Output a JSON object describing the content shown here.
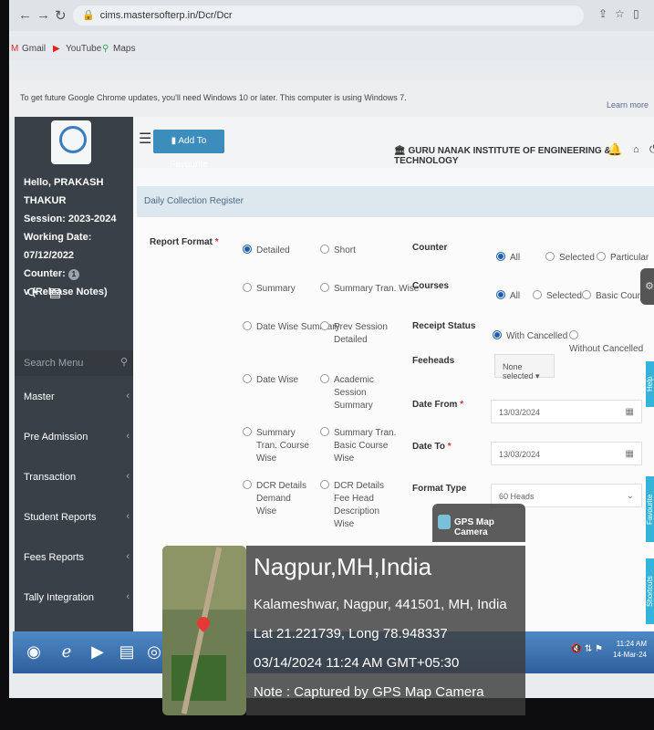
{
  "browser": {
    "url": "cims.mastersofterp.in/Dcr/Dcr",
    "bookmarks": [
      "Gmail",
      "YouTube",
      "Maps"
    ],
    "infobar_message": "To get future Google Chrome updates, you'll need Windows 10 or later. This computer is using Windows 7.",
    "infobar_link": "Learn more"
  },
  "sidebar": {
    "greeting": "Hello, PRAKASH THAKUR",
    "session": "Session: 2023-2024",
    "working_date": "Working Date: 07/12/2022",
    "counter_label": "Counter:",
    "counter_value": "1",
    "release_notes": "v (Release Notes)",
    "search_placeholder": "Search Menu",
    "menu": [
      "Master",
      "Pre Admission",
      "Transaction",
      "Student Reports",
      "Fees Reports",
      "Tally Integration"
    ]
  },
  "topbar": {
    "favourite_label": "Add To Favourite",
    "institute": "GURU NANAK INSTITUTE OF ENGINEERING & TECHNOLOGY"
  },
  "page": {
    "title": "Daily Collection Register",
    "report_format_label": "Report Format",
    "report_options": [
      {
        "label": "Detailed",
        "selected": true
      },
      {
        "label": "Short",
        "selected": false
      },
      {
        "label": "Summary",
        "selected": false
      },
      {
        "label": "Summary Tran. Wise",
        "selected": false
      },
      {
        "label": "Date Wise Summary",
        "selected": false
      },
      {
        "label": "Prev Session Detailed",
        "selected": false
      },
      {
        "label": "Date Wise",
        "selected": false
      },
      {
        "label": "Academic Session Summary",
        "selected": false
      },
      {
        "label": "Summary Tran. Course Wise",
        "selected": false
      },
      {
        "label": "Summary Tran. Basic Course Wise",
        "selected": false
      },
      {
        "label": "DCR Details Demand Wise",
        "selected": false
      },
      {
        "label": "DCR Details Fee Head Description Wise",
        "selected": false
      }
    ],
    "counter": {
      "label": "Counter",
      "options": [
        "All",
        "Selected",
        "Particular"
      ]
    },
    "courses": {
      "label": "Courses",
      "options": [
        "All",
        "Selected",
        "Basic Course"
      ]
    },
    "receipt_status": {
      "label": "Receipt Status",
      "options": [
        "With Cancelled",
        "Without Cancelled"
      ]
    },
    "feeheads": {
      "label": "Feeheads",
      "value": "None selected"
    },
    "date_from": {
      "label": "Date From",
      "value": "13/03/2024"
    },
    "date_to": {
      "label": "Date To",
      "value": "13/03/2024"
    },
    "format_type": {
      "label": "Format Type",
      "value": "60 Heads"
    }
  },
  "edge_tabs": [
    "Help",
    "Favourite",
    "Shortcuts"
  ],
  "taskbar": {
    "time": "11:24 AM",
    "date": "14-Mar-24"
  },
  "gps": {
    "brand": "GPS Map Camera",
    "city": "Nagpur,MH,India",
    "address": "Kalameshwar, Nagpur, 441501, MH, India",
    "coords": "Lat 21.221739, Long 78.948337",
    "datetime": "03/14/2024 11:24 AM GMT+05:30",
    "note": "Note : Captured by GPS Map Camera"
  }
}
